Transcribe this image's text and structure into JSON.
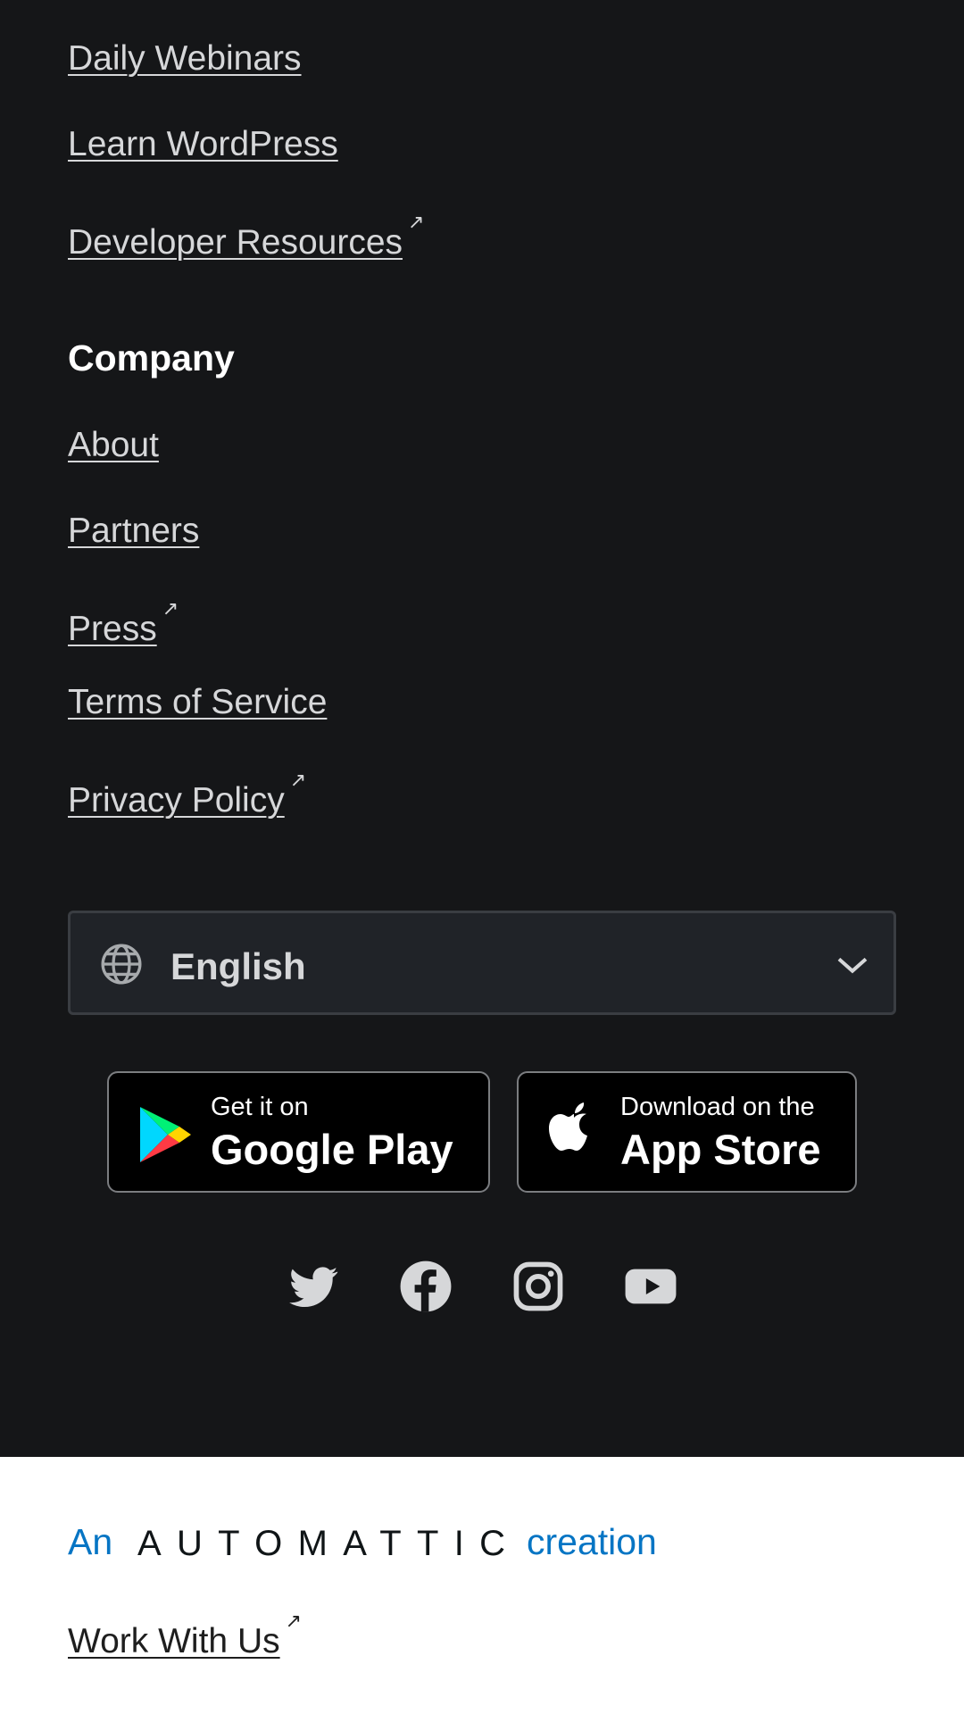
{
  "resources": {
    "links": [
      {
        "label": "Daily Webinars",
        "external": false
      },
      {
        "label": "Learn WordPress",
        "external": false
      },
      {
        "label": "Developer Resources",
        "external": true
      }
    ]
  },
  "company": {
    "heading": "Company",
    "links": [
      {
        "label": "About",
        "external": false
      },
      {
        "label": "Partners",
        "external": false
      },
      {
        "label": "Press",
        "external": true
      },
      {
        "label": "Terms of Service",
        "external": false
      },
      {
        "label": "Privacy Policy",
        "external": true
      }
    ]
  },
  "external_marker": "↗",
  "language_selector": {
    "selected": "English",
    "icon": "globe-icon"
  },
  "app_badges": {
    "google_play": {
      "small": "Get it on",
      "big": "Google Play",
      "icon": "google-play-icon"
    },
    "app_store": {
      "small": "Download on the",
      "big": "App Store",
      "icon": "apple-icon"
    }
  },
  "social_icons": [
    "twitter-icon",
    "facebook-icon",
    "instagram-icon",
    "youtube-icon"
  ],
  "bottom": {
    "prefix": "An",
    "brand": "AUTOMATTIC",
    "suffix": "creation",
    "work_link": "Work With Us"
  },
  "colors": {
    "background_dark": "#151618",
    "link": "#d6d7d9",
    "accent_blue": "#0675c4"
  }
}
